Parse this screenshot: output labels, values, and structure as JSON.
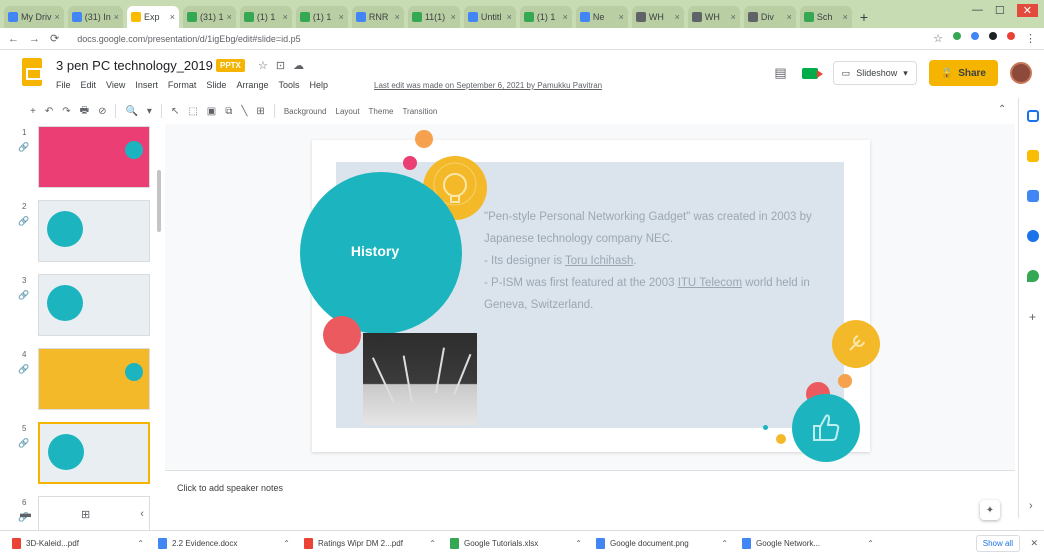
{
  "browser": {
    "tabs": [
      {
        "label": "My Driv",
        "color": "#4285f4"
      },
      {
        "label": "(31) In",
        "color": "#4285f4"
      },
      {
        "label": "Exp",
        "color": "#fbbc04",
        "active": true
      },
      {
        "label": "(31) 1",
        "color": "#34a853"
      },
      {
        "label": "(1) 1",
        "color": "#34a853"
      },
      {
        "label": "(1) 1",
        "color": "#34a853"
      },
      {
        "label": "RNR",
        "color": "#4285f4"
      },
      {
        "label": "11(1)",
        "color": "#34a853"
      },
      {
        "label": "Untitl",
        "color": "#4285f4"
      },
      {
        "label": "(1) 1",
        "color": "#34a853"
      },
      {
        "label": "Ne",
        "color": "#4285f4"
      },
      {
        "label": "WH",
        "color": "#5f6368"
      },
      {
        "label": "WH",
        "color": "#5f6368"
      },
      {
        "label": "Div",
        "color": "#5f6368"
      },
      {
        "label": "Sch",
        "color": "#34a853"
      }
    ],
    "tab_close": "×",
    "new_tab": "+",
    "url": "docs.google.com/presentation/d/1igEbg/edit#slide=id.p5",
    "nav": {
      "back": "←",
      "forward": "→",
      "reload": "⟳",
      "lock": "🔒"
    }
  },
  "app": {
    "title": "3 pen PC technology_2019",
    "badge": "PPTX",
    "menu": [
      "File",
      "Edit",
      "View",
      "Insert",
      "Format",
      "Slide",
      "Arrange",
      "Tools",
      "Help"
    ],
    "last_edit": "Last edit was made on September 6, 2021 by Pamukku Pavitran",
    "slideshow_label": "Slideshow",
    "share_label": "Share"
  },
  "toolbar": {
    "items": [
      "+",
      "↶",
      "↷",
      "🖶",
      "⊘",
      "🔍",
      "▾",
      "↖",
      "⬚",
      "▣",
      "⧉",
      "╲",
      "⊞"
    ],
    "text_items": [
      "Background",
      "Layout",
      "Theme",
      "Transition"
    ],
    "collapse": "⌃"
  },
  "filmstrip": {
    "slide_numbers": [
      "1",
      "2",
      "3",
      "4",
      "5",
      "6"
    ],
    "selected_index": 5,
    "bottom_icons": [
      "▬",
      "⊞",
      "‹"
    ]
  },
  "slide": {
    "heading": "History",
    "bullets": [
      {
        "text": "\"Pen-style Personal Networking Gadget\" was created in 2003 by Japanese technology company NEC.",
        "dash": false
      },
      {
        "text_before": "Its designer is ",
        "link": "Toru Ichihash",
        "text_after": ".",
        "dash": true
      },
      {
        "text_before": "P-ISM was first featured at the 2003 ",
        "link": "ITU Telecom",
        "text_after": " world held in Geneva, Switzerland.",
        "dash": true
      }
    ],
    "colors": {
      "teal": "#1cb5bf",
      "coral": "#eb5a5e",
      "yellow": "#f4b929",
      "orange": "#f6a14d",
      "panel": "#dbe4ec"
    }
  },
  "notes": {
    "placeholder": "Click to add speaker notes"
  },
  "downloads": [
    {
      "name": "3D-Kaleid...pdf",
      "color": "#ea4335"
    },
    {
      "name": "2.2 Evidence.docx",
      "color": "#4285f4"
    },
    {
      "name": "Ratings Wipr DM 2...pdf",
      "color": "#ea4335"
    },
    {
      "name": "Google Tutorials.xlsx",
      "color": "#34a853"
    },
    {
      "name": "Google document.png",
      "color": "#4285f4"
    },
    {
      "name": "Google Network...",
      "color": "#4285f4"
    }
  ],
  "show_all": "Show all"
}
